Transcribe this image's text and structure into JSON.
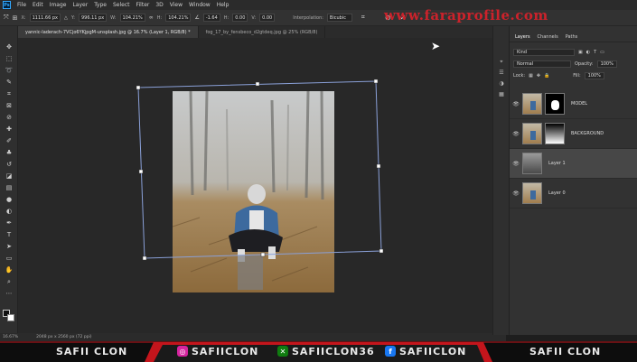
{
  "menu": {
    "logo": "Ps",
    "items": [
      "File",
      "Edit",
      "Image",
      "Layer",
      "Type",
      "Select",
      "Filter",
      "3D",
      "View",
      "Window",
      "Help"
    ]
  },
  "options": {
    "x_label": "X:",
    "x_value": "1111.66 px",
    "y_label": "Y:",
    "y_value": "996.11 px",
    "w_label": "W:",
    "w_value": "104.21%",
    "h_label": "H:",
    "h_value": "104.21%",
    "angle_value": "-1.64",
    "hskew_label": "H:",
    "hskew_value": "0.00",
    "vskew_label": "V:",
    "vskew_value": "0.00",
    "interp_label": "Interpolation:",
    "interp_value": "Bicubic",
    "cancel_label": "⊘",
    "commit_label": "✓"
  },
  "tabs": [
    {
      "label": "yannic-laderach-7VCjo6YKjpgM-unsplash.jpg @ 16.7% (Layer 1, RGB/8) *",
      "active": true
    },
    {
      "label": "fog_17_by_fensbeco_d2gtdeq.jpg @ 25% (RGB/8)",
      "active": false
    }
  ],
  "status": {
    "zoom": "16.67%",
    "size": "2048 px x 2560 px (72 ppi)"
  },
  "panel": {
    "tabs": [
      "Layers",
      "Channels",
      "Paths"
    ],
    "kind_label": "Kind",
    "blend": "Normal",
    "opacity_label": "Opacity:",
    "opacity": "100%",
    "lock_label": "Lock:",
    "fill_label": "Fill:",
    "fill": "100%",
    "layers": [
      {
        "name": "MODEL"
      },
      {
        "name": "BACKGROUND"
      },
      {
        "name": "Layer 1"
      },
      {
        "name": "Layer 0"
      }
    ]
  },
  "banner": {
    "left": "SAFII CLON",
    "instagram": "SAFIICLON",
    "xbox": "SAFIICLON36",
    "facebook": "SAFIICLON",
    "right": "SAFII CLON"
  },
  "watermark": "www.faraprofile.com",
  "colors": {
    "accent": "#e8202a",
    "selection": "#8aa0d8"
  }
}
